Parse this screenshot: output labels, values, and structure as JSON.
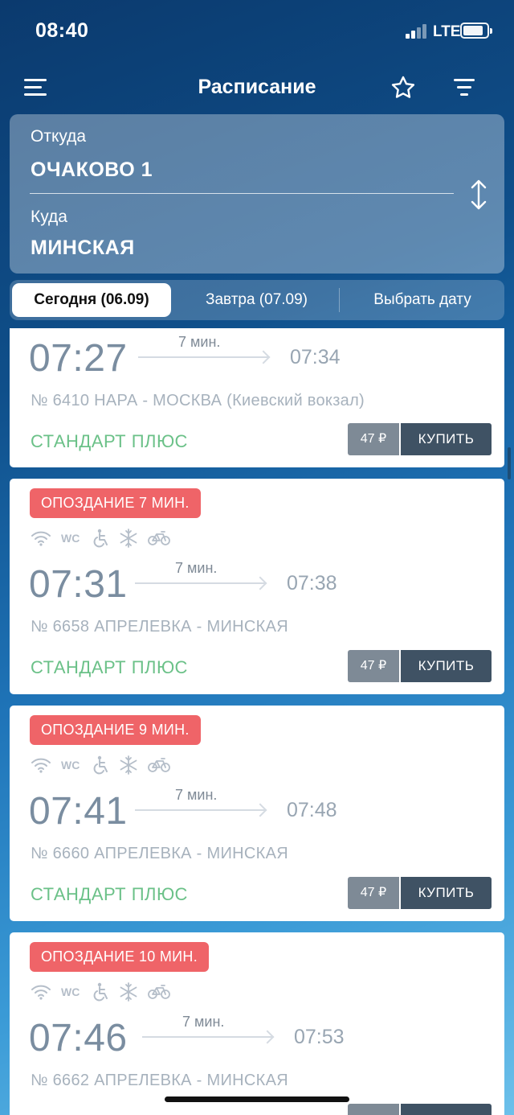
{
  "status_bar": {
    "time": "08:40",
    "network": "LTE"
  },
  "nav": {
    "title": "Расписание"
  },
  "route": {
    "from_label": "Откуда",
    "from_value": "ОЧАКОВО 1",
    "to_label": "Куда",
    "to_value": "МИНСКАЯ"
  },
  "date_tabs": {
    "today": "Сегодня (06.09)",
    "tomorrow": "Завтра (07.09)",
    "pick": "Выбрать дату"
  },
  "icons": {
    "menu": "menu-icon",
    "favorite": "star-icon",
    "filter": "filter-icon",
    "swap": "swap-icon",
    "wifi": "wifi-icon",
    "wc": "WC",
    "wheelchair": "wheelchair-icon",
    "climate": "snowflake-icon",
    "bike": "bicycle-icon"
  },
  "trains": [
    {
      "delay": "",
      "departure": "07:27",
      "duration": "7 мин.",
      "arrival": "07:34",
      "info": "№ 6410 НАРА - МОСКВА (Киевский вокзал)",
      "class": "СТАНДАРТ ПЛЮС",
      "price": "47 ₽",
      "buy_label": "КУПИТЬ"
    },
    {
      "delay": "ОПОЗДАНИЕ 7 МИН.",
      "departure": "07:31",
      "duration": "7 мин.",
      "arrival": "07:38",
      "info": "№ 6658 АПРЕЛЕВКА - МИНСКАЯ",
      "class": "СТАНДАРТ ПЛЮС",
      "price": "47 ₽",
      "buy_label": "КУПИТЬ"
    },
    {
      "delay": "ОПОЗДАНИЕ 9 МИН.",
      "departure": "07:41",
      "duration": "7 мин.",
      "arrival": "07:48",
      "info": "№ 6660 АПРЕЛЕВКА - МИНСКАЯ",
      "class": "СТАНДАРТ ПЛЮС",
      "price": "47 ₽",
      "buy_label": "КУПИТЬ"
    },
    {
      "delay": "ОПОЗДАНИЕ 10 МИН.",
      "departure": "07:46",
      "duration": "7 мин.",
      "arrival": "07:53",
      "info": "№ 6662 АПРЕЛЕВКА - МИНСКАЯ",
      "class": "",
      "price": "",
      "buy_label": ""
    }
  ]
}
